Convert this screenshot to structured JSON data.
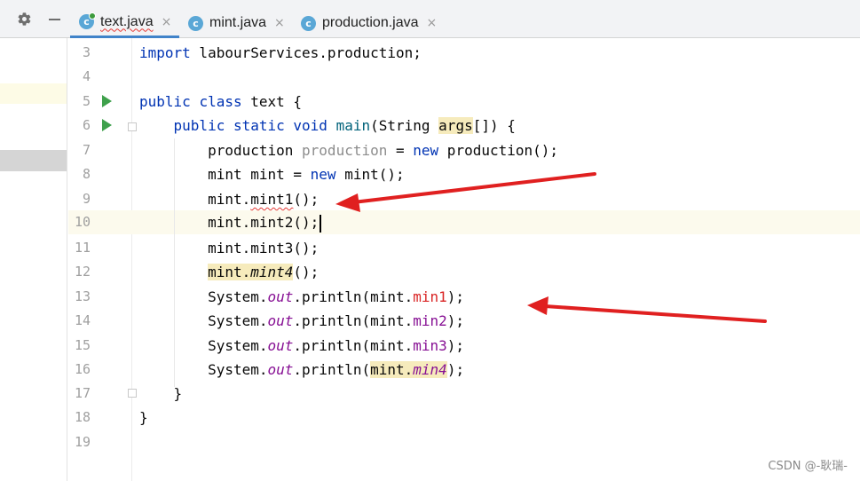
{
  "toolbar": {
    "settings_icon": "gear-icon",
    "minimize_icon": "minus-icon"
  },
  "tabs": [
    {
      "label": "text.java",
      "icon": "java-class-icon",
      "close": "×",
      "active": true
    },
    {
      "label": "mint.java",
      "icon": "java-class-icon",
      "close": "×",
      "active": false
    },
    {
      "label": "production.java",
      "icon": "java-class-icon",
      "close": "×",
      "active": false
    }
  ],
  "editor": {
    "current_line": "10",
    "lines": [
      {
        "num": "3",
        "t": [
          "import",
          " labourServices.production;"
        ]
      },
      {
        "num": "4",
        "t": []
      },
      {
        "num": "5",
        "t": [
          "public",
          " ",
          "class",
          " text {"
        ]
      },
      {
        "num": "6",
        "t": [
          "    ",
          "public",
          " ",
          "static",
          " ",
          "void",
          " ",
          "main",
          "(String ",
          "args",
          "[]) {"
        ]
      },
      {
        "num": "7",
        "t": [
          "        production ",
          "production",
          " = ",
          "new",
          " production();"
        ]
      },
      {
        "num": "8",
        "t": [
          "        mint mint = ",
          "new",
          " mint();"
        ]
      },
      {
        "num": "9",
        "t": [
          "        mint.",
          "mint1",
          "();"
        ]
      },
      {
        "num": "10",
        "t": [
          "        mint.mint2();"
        ]
      },
      {
        "num": "11",
        "t": [
          "        mint.mint3();"
        ]
      },
      {
        "num": "12",
        "t": [
          "        ",
          "mint.",
          "mint4",
          "();"
        ]
      },
      {
        "num": "13",
        "t": [
          "        System.",
          "out",
          ".println(mint.",
          "min1",
          ");"
        ]
      },
      {
        "num": "14",
        "t": [
          "        System.",
          "out",
          ".println(mint.",
          "min2",
          ");"
        ]
      },
      {
        "num": "15",
        "t": [
          "        System.",
          "out",
          ".println(mint.",
          "min3",
          ");"
        ]
      },
      {
        "num": "16",
        "t": [
          "        System.",
          "out",
          ".println(",
          "mint.",
          "min4",
          ");"
        ]
      },
      {
        "num": "17",
        "t": [
          "    }"
        ]
      },
      {
        "num": "18",
        "t": [
          "}"
        ]
      },
      {
        "num": "19",
        "t": []
      }
    ]
  },
  "annotations": {
    "arrow_color": "#e02020",
    "arrow_count": 2
  },
  "watermark": "CSDN @-耿瑞-"
}
